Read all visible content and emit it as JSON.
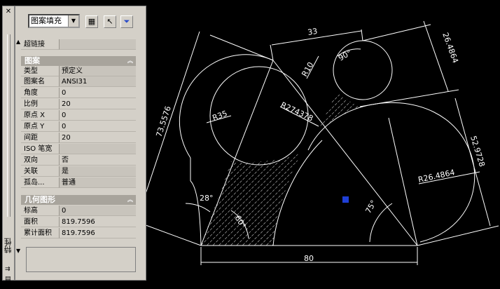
{
  "palette": {
    "panel_bg": "#d4d0c8",
    "canvas_bg": "#000000",
    "line": "#ffffff",
    "grip_marker": "#1f3fd6"
  },
  "strip": {
    "close_label": "✕",
    "title": "特性",
    "icon_a": "⇉",
    "icon_b": "▤"
  },
  "toolbar": {
    "object_type": "图案填充",
    "dropdown_icon": "chevron-down-icon",
    "btn_select_icon": "quick-select-icon",
    "btn_pick_icon": "select-objects-icon",
    "btn_filter_icon": "filter-icon"
  },
  "hyperlink": {
    "key": "超链接",
    "value": ""
  },
  "pattern_section": {
    "title": "图案",
    "rows": [
      {
        "key": "类型",
        "value": "预定义"
      },
      {
        "key": "图案名",
        "value": "ANSI31"
      },
      {
        "key": "角度",
        "value": "0"
      },
      {
        "key": "比例",
        "value": "20"
      },
      {
        "key": "原点 X",
        "value": "0"
      },
      {
        "key": "原点 Y",
        "value": "0"
      },
      {
        "key": "间距",
        "value": "20"
      },
      {
        "key": "ISO 笔宽",
        "value": ""
      },
      {
        "key": "双向",
        "value": "否"
      },
      {
        "key": "关联",
        "value": "是"
      },
      {
        "key": "孤岛...",
        "value": "普通"
      }
    ]
  },
  "geometry_section": {
    "title": "几何图形",
    "rows": [
      {
        "key": "标高",
        "value": "0"
      },
      {
        "key": "面积",
        "value": "819.7596"
      },
      {
        "key": "累计面积",
        "value": "819.7596"
      }
    ]
  },
  "drawing": {
    "dimensions": {
      "d33": "33",
      "d26": "26.4864",
      "d73": "73.5576",
      "d52": "52.9728",
      "d80": "80",
      "r10": "R10",
      "a90": "90°",
      "r35": "R35",
      "r274": "R274378",
      "r26": "R26.4864",
      "a28": "28°",
      "a60": "60°",
      "a75": "75°"
    }
  }
}
